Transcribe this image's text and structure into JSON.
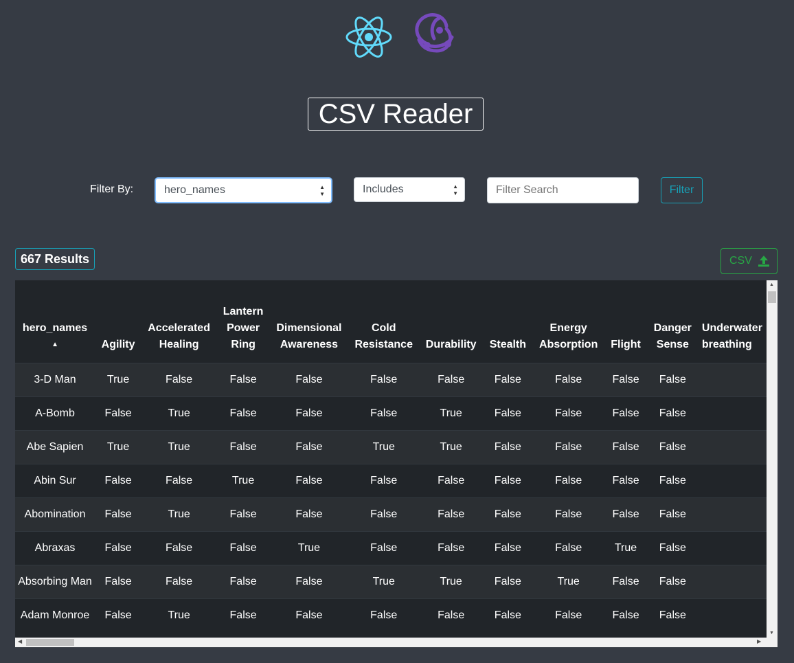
{
  "app": {
    "title": "CSV Reader"
  },
  "filter": {
    "label": "Filter By:",
    "field_value": "hero_names",
    "operator_value": "Includes",
    "search_placeholder": "Filter Search",
    "button_label": "Filter"
  },
  "results": {
    "count_label": "667 Results"
  },
  "csv_button": {
    "label": "CSV",
    "icon": "upload-icon"
  },
  "colors": {
    "accent_info": "#17a2b8",
    "accent_success": "#28a745",
    "background": "#363b44",
    "table_bg": "#212529"
  },
  "table": {
    "headers": [
      "hero_names",
      "Agility",
      "Accelerated Healing",
      "Lantern Power Ring",
      "Dimensional Awareness",
      "Cold Resistance",
      "Durability",
      "Stealth",
      "Energy Absorption",
      "Flight",
      "Danger Sense",
      "Underwater breathing"
    ],
    "sorted_column": "hero_names",
    "sort_direction": "ascending",
    "rows": [
      [
        "3-D Man",
        "True",
        "False",
        "False",
        "False",
        "False",
        "False",
        "False",
        "False",
        "False",
        "False"
      ],
      [
        "A-Bomb",
        "False",
        "True",
        "False",
        "False",
        "False",
        "True",
        "False",
        "False",
        "False",
        "False"
      ],
      [
        "Abe Sapien",
        "True",
        "True",
        "False",
        "False",
        "True",
        "True",
        "False",
        "False",
        "False",
        "False"
      ],
      [
        "Abin Sur",
        "False",
        "False",
        "True",
        "False",
        "False",
        "False",
        "False",
        "False",
        "False",
        "False"
      ],
      [
        "Abomination",
        "False",
        "True",
        "False",
        "False",
        "False",
        "False",
        "False",
        "False",
        "False",
        "False"
      ],
      [
        "Abraxas",
        "False",
        "False",
        "False",
        "True",
        "False",
        "False",
        "False",
        "False",
        "True",
        "False"
      ],
      [
        "Absorbing Man",
        "False",
        "False",
        "False",
        "False",
        "True",
        "True",
        "False",
        "True",
        "False",
        "False"
      ],
      [
        "Adam Monroe",
        "False",
        "True",
        "False",
        "False",
        "False",
        "False",
        "False",
        "False",
        "False",
        "False"
      ]
    ]
  }
}
